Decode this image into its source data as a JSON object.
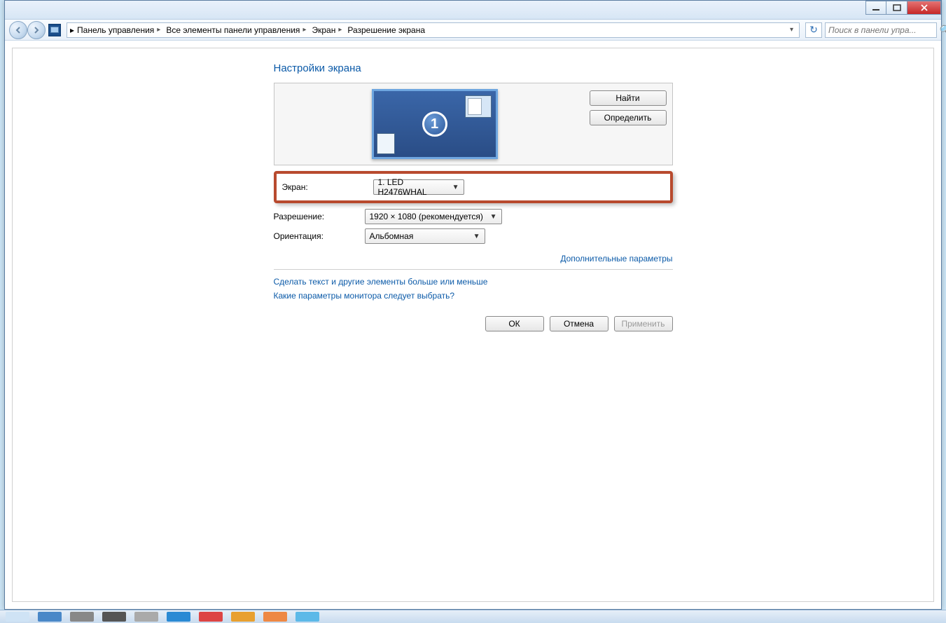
{
  "breadcrumb": {
    "items": [
      "Панель управления",
      "Все элементы панели управления",
      "Экран",
      "Разрешение экрана"
    ]
  },
  "search": {
    "placeholder": "Поиск в панели упра..."
  },
  "page": {
    "heading": "Настройки экрана"
  },
  "preview": {
    "monitor_number": "1",
    "find_label": "Найти",
    "identify_label": "Определить"
  },
  "form": {
    "screen_label": "Экран:",
    "screen_value": "1. LED H2476WHAL",
    "resolution_label": "Разрешение:",
    "resolution_value": "1920 × 1080 (рекомендуется)",
    "orientation_label": "Ориентация:",
    "orientation_value": "Альбомная"
  },
  "links": {
    "advanced": "Дополнительные параметры",
    "text_size": "Сделать текст и другие элементы больше или меньше",
    "which_settings": "Какие параметры монитора следует выбрать?"
  },
  "buttons": {
    "ok": "ОК",
    "cancel": "Отмена",
    "apply": "Применить"
  }
}
